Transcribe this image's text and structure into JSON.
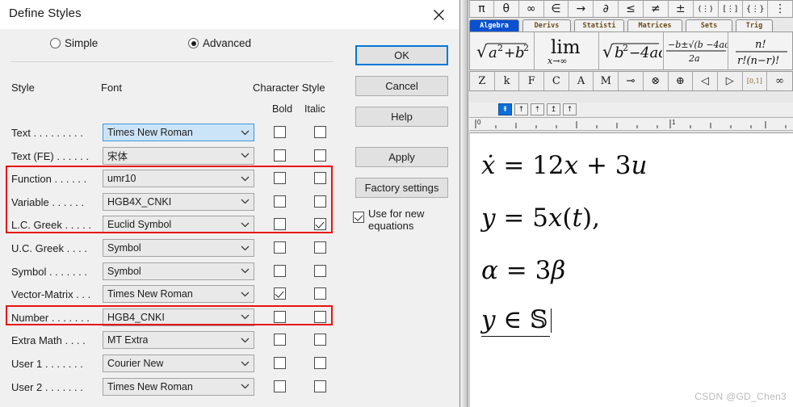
{
  "dialog": {
    "title": "Define Styles",
    "close_icon": "close-icon",
    "mode": {
      "simple_label": "Simple",
      "advanced_label": "Advanced",
      "selected": "Advanced"
    },
    "headers": {
      "style": "Style",
      "font": "Font",
      "character_style": "Character Style",
      "bold": "Bold",
      "italic": "Italic"
    },
    "rows": [
      {
        "label": "Text . . . . . . . . .",
        "font": "Times New Roman",
        "bold": false,
        "italic": false,
        "selected": true,
        "highlight": false
      },
      {
        "label": "Text (FE) . . . . . .",
        "font": "宋体",
        "bold": false,
        "italic": false,
        "selected": false,
        "highlight": false
      },
      {
        "label": "Function . . . . . .",
        "font": "umr10",
        "bold": false,
        "italic": false,
        "selected": false,
        "highlight": true
      },
      {
        "label": "Variable . . . . . .",
        "font": "HGB4X_CNKI",
        "bold": false,
        "italic": false,
        "selected": false,
        "highlight": true
      },
      {
        "label": "L.C. Greek . . . . .",
        "font": "Euclid Symbol",
        "bold": false,
        "italic": true,
        "selected": false,
        "highlight": true
      },
      {
        "label": "U.C. Greek . . . .",
        "font": "Symbol",
        "bold": false,
        "italic": false,
        "selected": false,
        "highlight": false
      },
      {
        "label": "Symbol . . . . . . .",
        "font": "Symbol",
        "bold": false,
        "italic": false,
        "selected": false,
        "highlight": false
      },
      {
        "label": "Vector-Matrix . . .",
        "font": "Times New Roman",
        "bold": true,
        "italic": false,
        "selected": false,
        "highlight": false
      },
      {
        "label": "Number . . . . . . .",
        "font": "HGB4_CNKI",
        "bold": false,
        "italic": false,
        "selected": false,
        "highlight": true
      },
      {
        "label": "Extra Math . . . .",
        "font": "MT Extra",
        "bold": false,
        "italic": false,
        "selected": false,
        "highlight": false
      },
      {
        "label": "User 1 . . . . . . .",
        "font": "Courier New",
        "bold": false,
        "italic": false,
        "selected": false,
        "highlight": false
      },
      {
        "label": "User 2 . . . . . . .",
        "font": "Times New Roman",
        "bold": false,
        "italic": false,
        "selected": false,
        "highlight": false
      }
    ],
    "buttons": {
      "ok": "OK",
      "cancel": "Cancel",
      "help": "Help",
      "apply": "Apply",
      "factory_settings": "Factory settings"
    },
    "use_for_new": {
      "label_line1": "Use for new",
      "label_line2": "equations",
      "checked": true
    },
    "annotation_color": "#e8140f"
  },
  "mathtype": {
    "symbol_row_1": [
      "π",
      "θ",
      "∞",
      "∈",
      "→",
      "∂",
      "≤",
      "≠",
      "±",
      "(⋮)",
      "[⋮]",
      "{⋮}",
      "⋮"
    ],
    "tabs": [
      {
        "label": "Algebra",
        "active": true
      },
      {
        "label": "Derivs",
        "active": false
      },
      {
        "label": "Statisti",
        "active": false
      },
      {
        "label": "Matrices",
        "active": false
      },
      {
        "label": "Sets",
        "active": false
      },
      {
        "label": "Trig",
        "active": false
      }
    ],
    "templates": [
      "sqrt(a^2 + b^2)",
      "lim x->infinity",
      "sqrt(b^2 - 4ac)",
      "(-b +- sqrt(b^2-4ac)) / 2a",
      "n! / (r!(n-r)!)"
    ],
    "symbol_row_2": [
      "Z",
      "k",
      "F",
      "C",
      "A",
      "M",
      "⊸",
      "⊗",
      "⊕",
      "◁",
      "▷",
      "[0,1]",
      "∞"
    ],
    "align_buttons": [
      {
        "icon": "align-left-icon",
        "active": true
      },
      {
        "icon": "align-center-icon",
        "active": false
      },
      {
        "icon": "align-right-icon",
        "active": false
      },
      {
        "icon": "align-equals-icon",
        "active": false
      },
      {
        "icon": "align-dot-icon",
        "active": false
      }
    ],
    "ruler": {
      "labels": [
        "0",
        "1"
      ]
    },
    "equations": [
      {
        "html": "<i>ẋ</i> = 12<i>x</i> + 3<i>u</i>"
      },
      {
        "html": "<i>y</i> = 5<i>x</i>(<i>t</i>),"
      },
      {
        "html": "<i>α</i> = 3<i>β</i>"
      },
      {
        "html": "<span class=\"underlined\"><i>y</i> ∈ 𝕊</span>"
      }
    ]
  },
  "watermark": "CSDN @GD_Chen3"
}
